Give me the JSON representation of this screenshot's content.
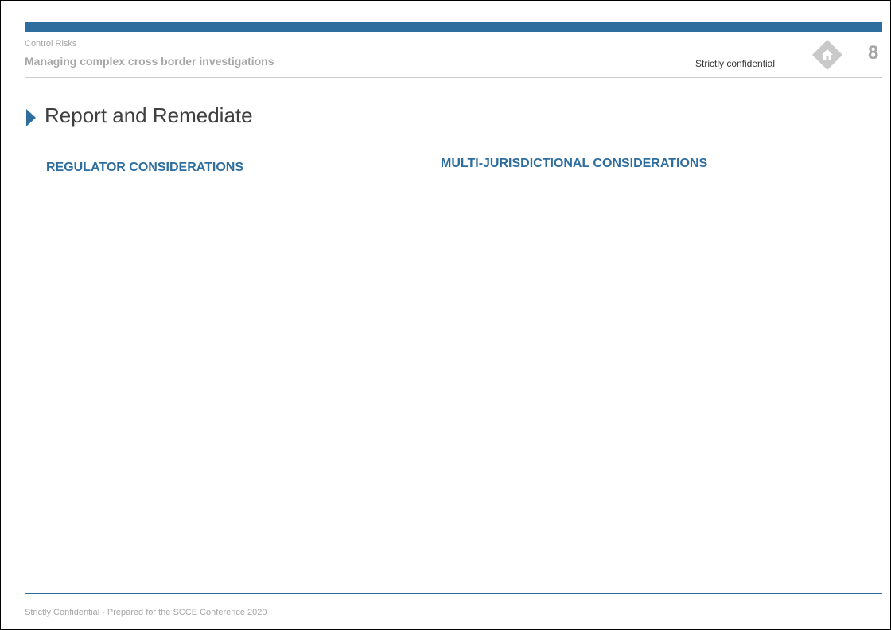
{
  "header": {
    "company": "Control Risks",
    "deck_title": "Managing complex cross border investigations",
    "confidential_label": "Strictly confidential",
    "page_number": "8"
  },
  "slide": {
    "title": "Report and Remediate",
    "columns": [
      {
        "heading": "REGULATOR CONSIDERATIONS"
      },
      {
        "heading": "MULTI-JURISDICTIONAL CONSIDERATIONS"
      }
    ]
  },
  "footer": {
    "text": "Strictly Confidential - Prepared for the SCCE Conference 2020"
  },
  "colors": {
    "brand_blue": "#2e6e9e",
    "muted_gray": "#a6a6a6"
  },
  "icons": {
    "home": "home-icon",
    "title_marker": "triangle-right-icon"
  }
}
